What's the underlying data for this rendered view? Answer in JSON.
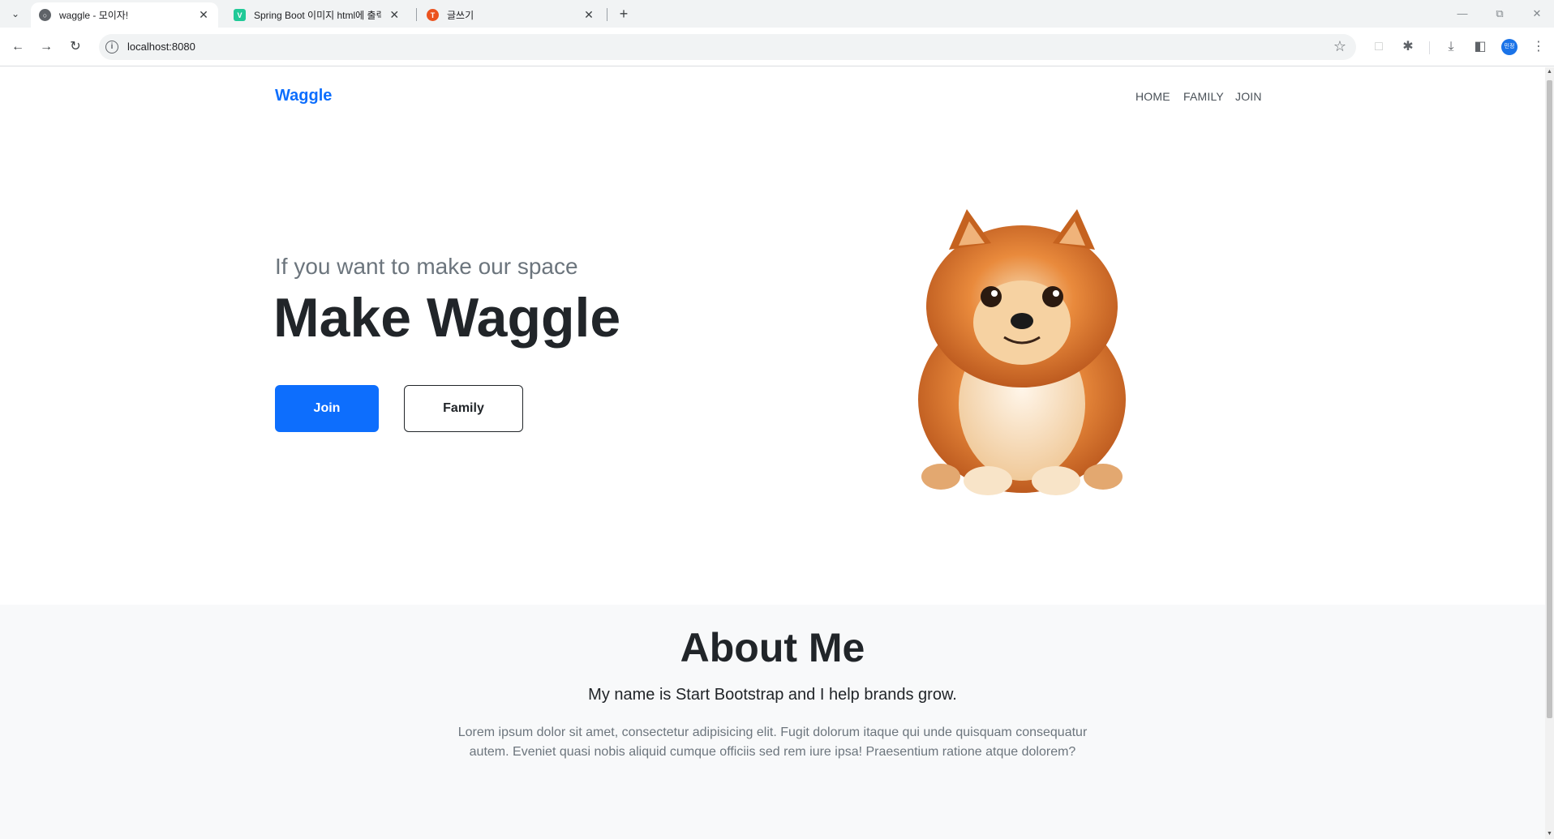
{
  "browser": {
    "tabs": [
      {
        "title": "waggle - 모이자!",
        "favicon": "globe-icon",
        "active": true
      },
      {
        "title": "Spring Boot 이미지 html에 출력",
        "favicon": "velog-icon",
        "active": false
      },
      {
        "title": "글쓰기",
        "favicon": "tistory-icon",
        "active": false
      }
    ],
    "url": "localhost:8080",
    "profile_initials": "민정",
    "colors": {
      "tab_bar": "#f1f3f4",
      "omnibox": "#f1f3f4",
      "profile": "#1a73e8"
    }
  },
  "site": {
    "brand": "Waggle",
    "nav": [
      "HOME",
      "FAMILY",
      "JOIN"
    ],
    "hero": {
      "subtitle": "If you want to make our space",
      "title": "Make Waggle",
      "join_button": "Join",
      "family_button": "Family"
    },
    "about": {
      "title": "About Me",
      "lead": "My name is Start Bootstrap and I help brands grow.",
      "text": "Lorem ipsum dolor sit amet, consectetur adipisicing elit. Fugit dolorum itaque qui unde quisquam consequatur autem. Eveniet quasi nobis aliquid cumque officiis sed rem iure ipsa! Praesentium ratione atque dolorem?"
    },
    "colors": {
      "primary": "#0d6efd",
      "dark": "#212529",
      "muted": "#6c757d",
      "section_bg": "#f8f9fa"
    }
  }
}
